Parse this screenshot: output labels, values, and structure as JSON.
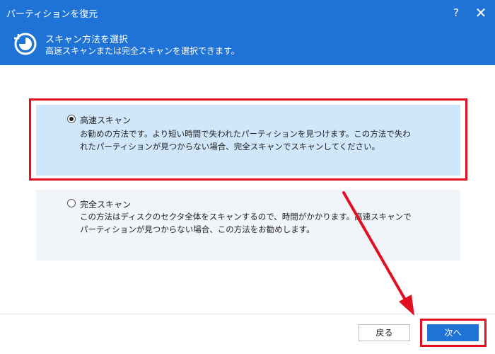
{
  "window": {
    "title": "パーティションを復元",
    "help_label": "?",
    "close_label": "✕"
  },
  "header": {
    "title": "スキャン方法を選択",
    "subtitle": "高速スキャンまたは完全スキャンを選択できます。",
    "icon": "restore-clock-icon"
  },
  "options": {
    "quick": {
      "label": "高速スキャン",
      "description": "お勧めの方法です。より短い時間で失われたパーティションを見つけます。この方法で失われたパーティションが見つからない場合、完全スキャンでスキャンしてください。",
      "selected": true
    },
    "full": {
      "label": "完全スキャン",
      "description": "この方法はディスクのセクタ全体をスキャンするので、時間がかかります。高速スキャンでパーティションが見つからない場合、この方法をお勧めします。",
      "selected": false
    }
  },
  "buttons": {
    "back": "戻る",
    "next": "次へ"
  },
  "colors": {
    "accent": "#1f73d6",
    "annotation": "#e01020",
    "selected_bg": "#cfe6fb",
    "unselected_bg": "#f1f4f9"
  }
}
